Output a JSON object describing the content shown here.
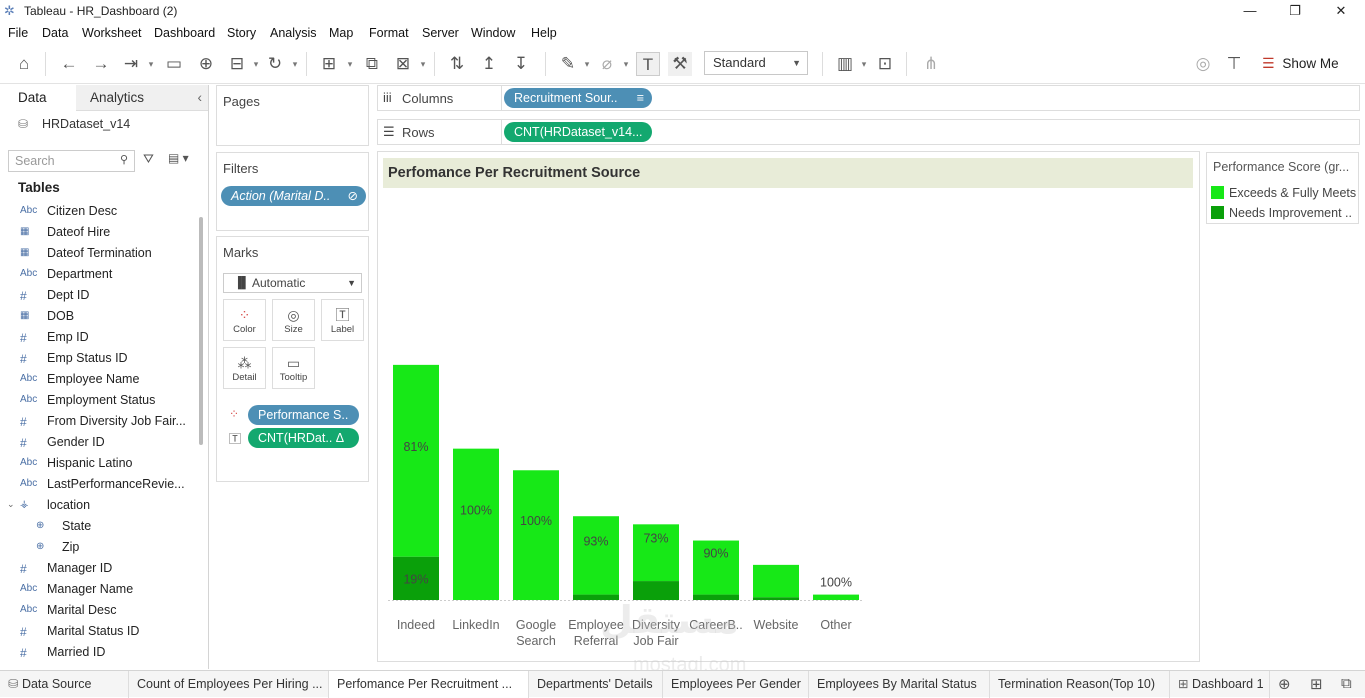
{
  "window": {
    "title": "Tableau - HR_Dashboard (2)"
  },
  "menu": [
    "File",
    "Data",
    "Worksheet",
    "Dashboard",
    "Story",
    "Analysis",
    "Map",
    "Format",
    "Server",
    "Window",
    "Help"
  ],
  "toolbar": {
    "fit": "Standard",
    "show_me": "Show Me"
  },
  "data_pane": {
    "tab_data": "Data",
    "tab_analytics": "Analytics",
    "datasource": "HRDataset_v14",
    "search_placeholder": "Search",
    "tables_label": "Tables",
    "fields": [
      {
        "type": "Abc",
        "name": "Citizen Desc"
      },
      {
        "type": "date",
        "name": "Dateof Hire"
      },
      {
        "type": "date",
        "name": "Dateof Termination"
      },
      {
        "type": "Abc",
        "name": "Department"
      },
      {
        "type": "#",
        "name": "Dept ID"
      },
      {
        "type": "date",
        "name": "DOB"
      },
      {
        "type": "#",
        "name": "Emp ID"
      },
      {
        "type": "#",
        "name": "Emp Status ID"
      },
      {
        "type": "Abc",
        "name": "Employee Name"
      },
      {
        "type": "Abc",
        "name": "Employment Status"
      },
      {
        "type": "#",
        "name": "From Diversity Job Fair..."
      },
      {
        "type": "#",
        "name": "Gender ID"
      },
      {
        "type": "Abc",
        "name": "Hispanic Latino"
      },
      {
        "type": "Abc",
        "name": "LastPerformanceRevie..."
      },
      {
        "type": "hier",
        "name": "location"
      },
      {
        "type": "geo",
        "name": "State",
        "sub": true
      },
      {
        "type": "geo",
        "name": "Zip",
        "sub": true
      },
      {
        "type": "#",
        "name": "Manager ID"
      },
      {
        "type": "Abc",
        "name": "Manager Name"
      },
      {
        "type": "Abc",
        "name": "Marital Desc"
      },
      {
        "type": "#",
        "name": "Marital Status ID"
      },
      {
        "type": "#",
        "name": "Married ID"
      }
    ]
  },
  "cards": {
    "pages": "Pages",
    "filters": "Filters",
    "filter_pill": "Action (Marital D..",
    "marks": "Marks",
    "mark_type": "Automatic",
    "mark_buttons": [
      "Color",
      "Size",
      "Label",
      "Detail",
      "Tooltip"
    ],
    "mark_pills": [
      "Performance S..",
      "CNT(HRDat.. Δ"
    ]
  },
  "shelves": {
    "columns_label": "Columns",
    "columns_pill": "Recruitment Sour..",
    "rows_label": "Rows",
    "rows_pill": "CNT(HRDataset_v14..."
  },
  "viz": {
    "title": "Perfomance Per Recruitment Source"
  },
  "legend": {
    "title": "Performance Score (gr...",
    "items": [
      {
        "label": "Exceeds & Fully Meets",
        "color": "#17e817"
      },
      {
        "label": "Needs Improvement ..",
        "color": "#0aa00a"
      }
    ]
  },
  "chart_data": {
    "type": "bar",
    "stacked": true,
    "categories": [
      "Indeed",
      "LinkedIn",
      "Google Search",
      "Employee Referral",
      "Diversity Job Fair",
      "CareerB..",
      "Website",
      "Other"
    ],
    "series": [
      {
        "name": "Exceeds & Fully Meets",
        "color": "#17e817",
        "values": [
          71,
          56,
          48,
          29,
          21,
          20,
          12,
          2
        ]
      },
      {
        "name": "Needs Improvement ..",
        "color": "#0aa00a",
        "values": [
          16,
          0,
          0,
          2,
          7,
          2,
          1,
          0
        ]
      }
    ],
    "labels_top": [
      "81%",
      "100%",
      "100%",
      "93%",
      "73%",
      "90%",
      "",
      "100%"
    ],
    "labels_bottom": [
      "19%",
      "",
      "",
      "",
      "",
      "",
      "",
      ""
    ],
    "ylim": [
      0,
      148
    ]
  },
  "sheet_tabs": [
    "Data Source",
    "Count of Employees Per Hiring ...",
    "Perfomance Per Recruitment ...",
    "Departments' Details",
    "Employees Per Gender",
    "Employees By Marital Status",
    "Termination Reason(Top 10)",
    "Dashboard 1"
  ],
  "watermark": {
    "text": "مستقل",
    "sub": "mostaql.com"
  }
}
